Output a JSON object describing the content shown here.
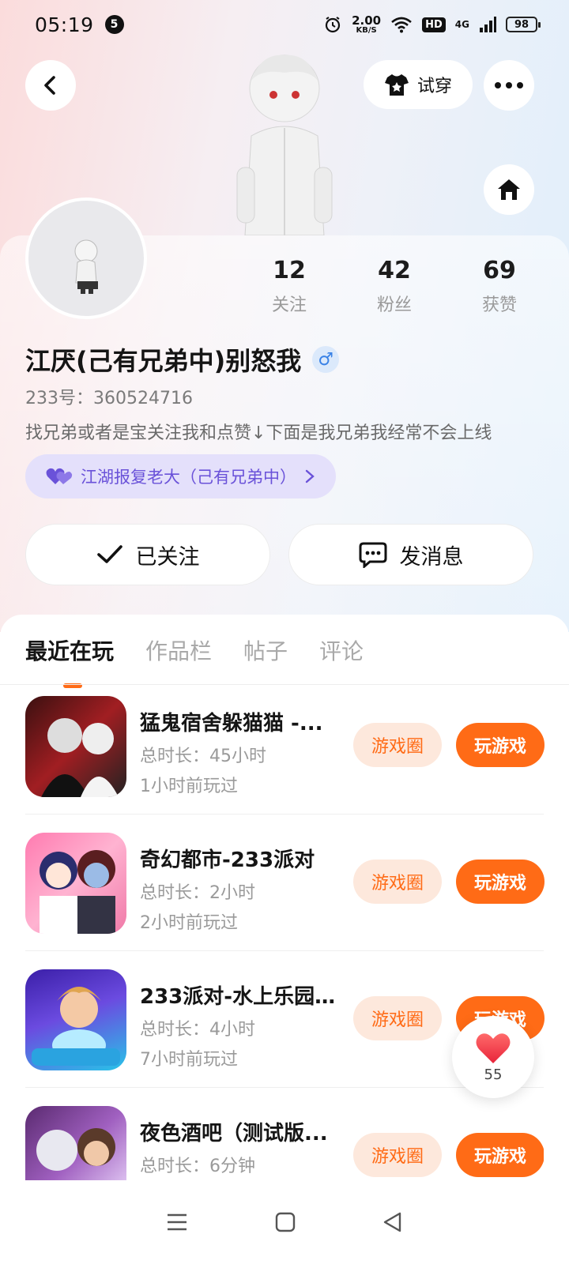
{
  "status_bar": {
    "time": "05:19",
    "notification_count": "5",
    "speed_value": "2.00",
    "speed_unit": "KB/S",
    "hd": "HD",
    "network": "4G",
    "battery": "98"
  },
  "header": {
    "try_on_label": "试穿",
    "back_icon": "back-arrow-icon",
    "more_icon": "more-dots-icon",
    "home_icon": "home-icon"
  },
  "profile": {
    "stats": [
      {
        "value": "12",
        "label": "关注"
      },
      {
        "value": "42",
        "label": "粉丝"
      },
      {
        "value": "69",
        "label": "获赞"
      }
    ],
    "name": "江厌(己有兄弟中)别怒我",
    "gender_symbol": "♂",
    "uid": "233号：360524716",
    "bio": "找兄弟或者是宝关注我和点赞↓下面是我兄弟我经常不会上线",
    "guild": "江湖报复老大（己有兄弟中）",
    "followed_label": "已关注",
    "message_label": "发消息"
  },
  "tabs": [
    {
      "label": "最近在玩",
      "active": true
    },
    {
      "label": "作品栏",
      "active": false
    },
    {
      "label": "帖子",
      "active": false
    },
    {
      "label": "评论",
      "active": false
    }
  ],
  "games": [
    {
      "title": "猛鬼宿舍躲猫猫 -...",
      "duration": "总时长：45小时",
      "last_played": "1小时前玩过",
      "circle_label": "游戏圈",
      "play_label": "玩游戏"
    },
    {
      "title": "奇幻都市-233派对",
      "duration": "总时长：2小时",
      "last_played": "2小时前玩过",
      "circle_label": "游戏圈",
      "play_label": "玩游戏"
    },
    {
      "title": "233派对-水上乐园...",
      "duration": "总时长：4小时",
      "last_played": "7小时前玩过",
      "circle_label": "游戏圈",
      "play_label": "玩游戏"
    },
    {
      "title": "夜色酒吧（测试版...",
      "duration": "总时长：6分钟",
      "last_played": "",
      "circle_label": "游戏圈",
      "play_label": "玩游戏"
    }
  ],
  "like_fab": {
    "count": "55"
  },
  "colors": {
    "accent": "#ff6b16",
    "guild_text": "#6a52d9",
    "guild_bg": "#e4e0fb"
  }
}
